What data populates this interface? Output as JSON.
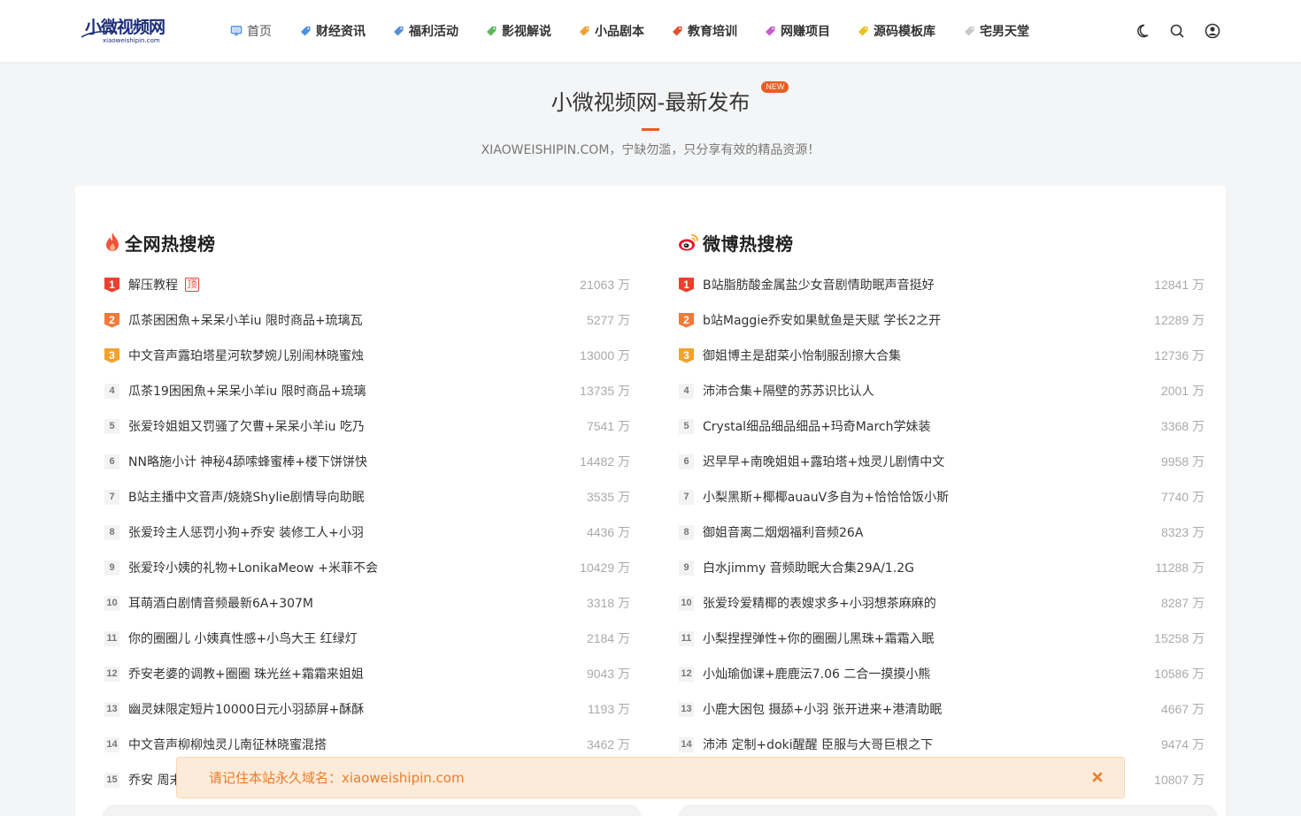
{
  "logo": {
    "text": "小微视频网",
    "sub": "xiaoweishipin.com"
  },
  "nav": [
    {
      "label": "首页",
      "icon": "monitor-icon",
      "color": "#4a8fd6"
    },
    {
      "label": "财经资讯",
      "icon": "tag-icon",
      "color": "#4a90e2"
    },
    {
      "label": "福利活动",
      "icon": "tag-icon",
      "color": "#5b8fcf"
    },
    {
      "label": "影视解说",
      "icon": "tag-icon",
      "color": "#5cb85c"
    },
    {
      "label": "小品剧本",
      "icon": "tag-icon",
      "color": "#f0a030"
    },
    {
      "label": "教育培训",
      "icon": "tag-icon",
      "color": "#e8502f"
    },
    {
      "label": "网赚项目",
      "icon": "tag-icon",
      "color": "#c45ec8"
    },
    {
      "label": "源码模板库",
      "icon": "tag-icon",
      "color": "#e8c020"
    },
    {
      "label": "宅男天堂",
      "icon": "tag-icon",
      "color": "#c8c8c8"
    }
  ],
  "header_icons": [
    "moon-icon",
    "search-icon",
    "user-icon"
  ],
  "hero": {
    "title": "小微视频网-最新发布",
    "badge": "NEW",
    "subtitle": "XIAOWEISHIPIN.COM，宁缺勿滥，只分享有效的精品资源！"
  },
  "colors": {
    "accent": "#ec5b22",
    "rank1": "#e8402f",
    "rank2": "#f27a3b",
    "rank3": "#f2a32a"
  },
  "unit": "万",
  "left": {
    "title": "全网热搜榜",
    "icon": "flame-icon",
    "items": [
      {
        "rank": "1",
        "title": "解压教程",
        "badge": "顶",
        "count": "21063"
      },
      {
        "rank": "2",
        "title": "瓜茶困困魚+呆呆小羊iu 限时商品+琉璃瓦",
        "count": "5277"
      },
      {
        "rank": "3",
        "title": "中文音声露珀塔星河软梦婉儿别闹林晓蜜烛",
        "count": "13000"
      },
      {
        "rank": "4",
        "title": "瓜茶19困困魚+呆呆小羊iu 限时商品+琉璃",
        "count": "13735"
      },
      {
        "rank": "5",
        "title": "张爱玲姐姐又罚骚了欠曹+呆呆小羊iu 吃乃",
        "count": "7541"
      },
      {
        "rank": "6",
        "title": "NN略施小计 神秘4舔嗦蜂蜜棒+楼下饼饼快",
        "count": "14482"
      },
      {
        "rank": "7",
        "title": "B站主播中文音声/娆娆Shylie剧情导向助眠",
        "count": "3535"
      },
      {
        "rank": "8",
        "title": "张爱玲主人惩罚小狗+乔安 装修工人+小羽",
        "count": "4436"
      },
      {
        "rank": "9",
        "title": "张爱玲小姨的礼物+LonikaMeow +米菲不会",
        "count": "10429"
      },
      {
        "rank": "10",
        "title": "耳萌酒白剧情音频最新6A+307M",
        "count": "3318"
      },
      {
        "rank": "11",
        "title": "你的圈圈儿 小姨真性感+小鸟大王 红绿灯",
        "count": "2184"
      },
      {
        "rank": "12",
        "title": "乔安老婆的调教+圈圈 珠光丝+霜霜来姐姐",
        "count": "9043"
      },
      {
        "rank": "13",
        "title": "幽灵妹限定短片10000日元小羽舔屏+酥酥",
        "count": "1193"
      },
      {
        "rank": "14",
        "title": "中文音声柳柳烛灵儿南征林晓蜜混搭",
        "count": "3462"
      },
      {
        "rank": "15",
        "title": "乔安 周末",
        "count": ""
      }
    ]
  },
  "right": {
    "title": "微博热搜榜",
    "icon": "weibo-icon",
    "items": [
      {
        "rank": "1",
        "title": "B站脂肪酸金属盐少女音剧情助眠声音挺好",
        "count": "12841"
      },
      {
        "rank": "2",
        "title": "b站Maggie乔安如果鱿鱼是天赋 学长2之开",
        "count": "12289"
      },
      {
        "rank": "3",
        "title": "御姐博主是甜菜小怡制服刮擦大合集",
        "count": "12736"
      },
      {
        "rank": "4",
        "title": "沛沛合集+隔壁的苏苏识比认人",
        "count": "2001"
      },
      {
        "rank": "5",
        "title": "Crystal细品细品细品+玛奇March学妹装",
        "count": "3368"
      },
      {
        "rank": "6",
        "title": "迟早早+南晚姐姐+露珀塔+烛灵儿剧情中文",
        "count": "9958"
      },
      {
        "rank": "7",
        "title": "小梨黑斯+椰椰auauV多自为+恰恰恰饭小斯",
        "count": "7740"
      },
      {
        "rank": "8",
        "title": "御姐音离二烟烟福利音频26A",
        "count": "8323"
      },
      {
        "rank": "9",
        "title": "白水jimmy 音频助眠大合集29A/1.2G",
        "count": "11288"
      },
      {
        "rank": "10",
        "title": "张爱玲爱精椰的表嫂求多+小羽想茶麻麻的",
        "count": "8287"
      },
      {
        "rank": "11",
        "title": "小梨捏捏弹性+你的圈圈儿黑珠+霜霜入眠",
        "count": "15258"
      },
      {
        "rank": "12",
        "title": "小灿瑜伽课+鹿鹿沄7.06 二合一摸摸小熊",
        "count": "10586"
      },
      {
        "rank": "13",
        "title": "小鹿大困包 摄舔+小羽 张开进来+港清助眠",
        "count": "4667"
      },
      {
        "rank": "14",
        "title": "沛沛 定制+doki醒醒 臣服与大哥巨根之下",
        "count": "9474"
      },
      {
        "rank": "15",
        "title": "",
        "count": "10807"
      }
    ]
  },
  "notice": {
    "text": "请记住本站永久域名：xiaoweishipin.com",
    "close_icon": "close-icon"
  }
}
